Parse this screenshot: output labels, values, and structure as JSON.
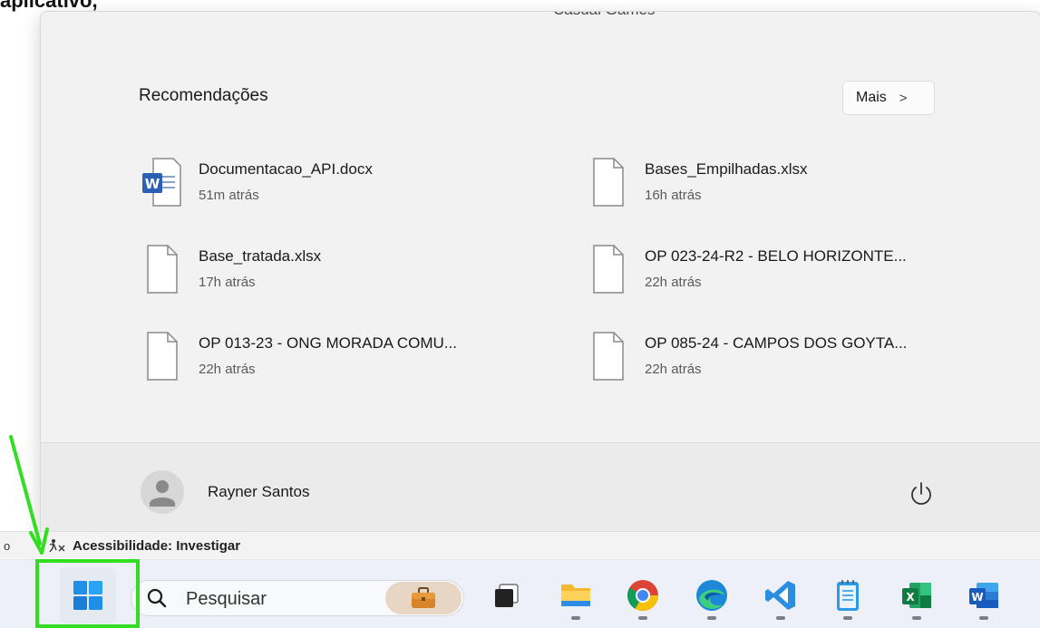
{
  "background": {
    "top_text": "aplicativo,",
    "zoom_fragment": "o",
    "accessibility_status": "Acessibilidade: Investigar"
  },
  "start_menu": {
    "games_label": "Casual Games",
    "recommendations_title": "Recomendações",
    "more_button": {
      "label": "Mais",
      "chevron": ">"
    },
    "recommendations": [
      {
        "name": "Documentacao_API.docx",
        "time": "51m atrás",
        "icon": "word-file-icon"
      },
      {
        "name": "Bases_Empilhadas.xlsx",
        "time": "16h atrás",
        "icon": "blank-file-icon"
      },
      {
        "name": "Base_tratada.xlsx",
        "time": "17h atrás",
        "icon": "blank-file-icon"
      },
      {
        "name": "OP 023-24-R2 - BELO HORIZONTE...",
        "time": "22h atrás",
        "icon": "blank-file-icon"
      },
      {
        "name": "OP 013-23 - ONG MORADA COMU...",
        "time": "22h atrás",
        "icon": "blank-file-icon"
      },
      {
        "name": "OP 085-24 - CAMPOS DOS GOYTA...",
        "time": "22h atrás",
        "icon": "blank-file-icon"
      }
    ],
    "user": {
      "name": "Rayner Santos"
    },
    "power_icon": "power-icon"
  },
  "taskbar": {
    "search_placeholder": "Pesquisar",
    "apps": [
      "task-view-icon",
      "file-explorer-icon",
      "chrome-icon",
      "edge-icon",
      "vscode-icon",
      "notepad-icon",
      "excel-icon",
      "word-icon"
    ]
  },
  "colors": {
    "highlight": "#33dd22",
    "menu_bg": "#f2f2f2",
    "taskbar_bg": "#edf1f7"
  }
}
